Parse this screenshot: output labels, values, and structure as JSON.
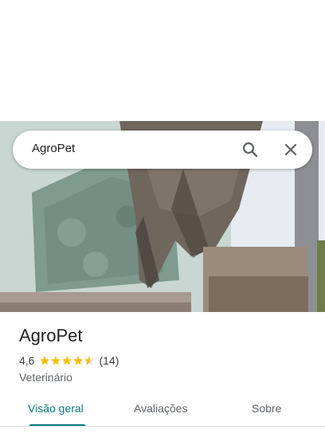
{
  "search": {
    "query": "AgroPet"
  },
  "icons": {
    "search": "search-icon",
    "close": "close-icon",
    "star": "star-icon",
    "half_star": "half-star-icon"
  },
  "place": {
    "name": "AgroPet",
    "rating": "4,6",
    "rating_fraction": 0.92,
    "stars_full": 4,
    "stars_half": 1,
    "review_count": "(14)",
    "category": "Veterinário"
  },
  "tabs": [
    {
      "label": "Visão geral",
      "active": true
    },
    {
      "label": "Avaliações",
      "active": false
    },
    {
      "label": "Sobre",
      "active": false
    }
  ],
  "colors": {
    "accent": "#0b7a80",
    "star": "#fbbc04"
  }
}
